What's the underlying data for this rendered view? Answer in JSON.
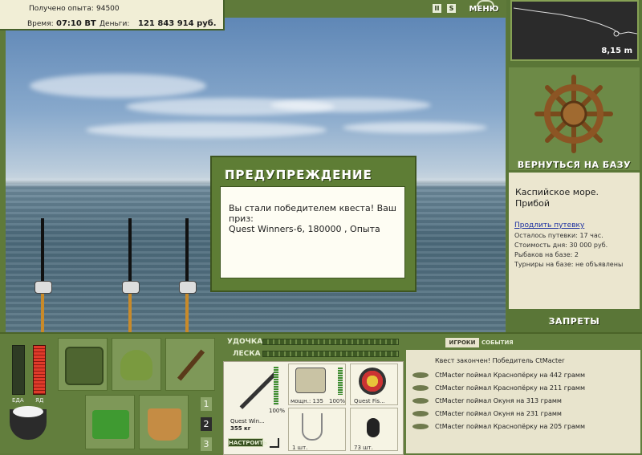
{
  "info": {
    "exp_label": "Получено опыта:",
    "exp_value": "94500",
    "time_label": "Время:",
    "time_value": "07:10 ВТ",
    "money_label": "Деньги:",
    "money_value": "121 843 914 руб."
  },
  "topbar": {
    "pause": "II",
    "sound": "S",
    "menu": "МЕНЮ"
  },
  "depth": {
    "value": "8,15 m"
  },
  "right": {
    "return_base": "ВЕРНУТЬСЯ НА БАЗУ",
    "location": "Каспийское море. Прибой",
    "extend_link": "Продлить путевку",
    "days_left": "Осталось путевки: 17 час.",
    "day_cost": "Стоимость дня: 30 000 руб.",
    "anglers": "Рыбаков на базе: 2",
    "tournaments": "Турниры на базе: не объявлены",
    "bans": "ЗАПРЕТЫ"
  },
  "dialog": {
    "title": "ПРЕДУПРЕЖДЕНИЕ",
    "line1": "Вы стали победителем квеста! Ваш приз:",
    "line2": "Quest Winners-6, 180000 , Опыта"
  },
  "bottom": {
    "food_label": "ЕДА",
    "poison_label": "ЯД",
    "rod_label": "УДОЧКА",
    "line_label": "ЛЕСКА",
    "pages": [
      "1",
      "2",
      "3"
    ],
    "rod_name": "Quest Win...",
    "rod_weight": "355 кг",
    "rod_percent": "100%",
    "setup_button": "НАСТРОИТЬ",
    "reel_info": "мощн.: 135",
    "reel_percent": "100%",
    "lure_name": "Quest Fis...",
    "hook_count": "1 шт.",
    "bait_count": "73 шт."
  },
  "events": {
    "tab_players": "ИГРОКИ",
    "tab_events": "СОБЫТИЯ",
    "header": "Квест закончен! Победитель CtMacter",
    "items": [
      "CtMacter поймал Краснопёрку на 442 грамм",
      "CtMacter поймал Краснопёрку на 211 грамм",
      "CtMacter поймал Окуня на 313 грамм",
      "CtMacter поймал Окуня на 231 грамм",
      "CtMacter поймал Краснопёрку на 205 грамм"
    ]
  }
}
